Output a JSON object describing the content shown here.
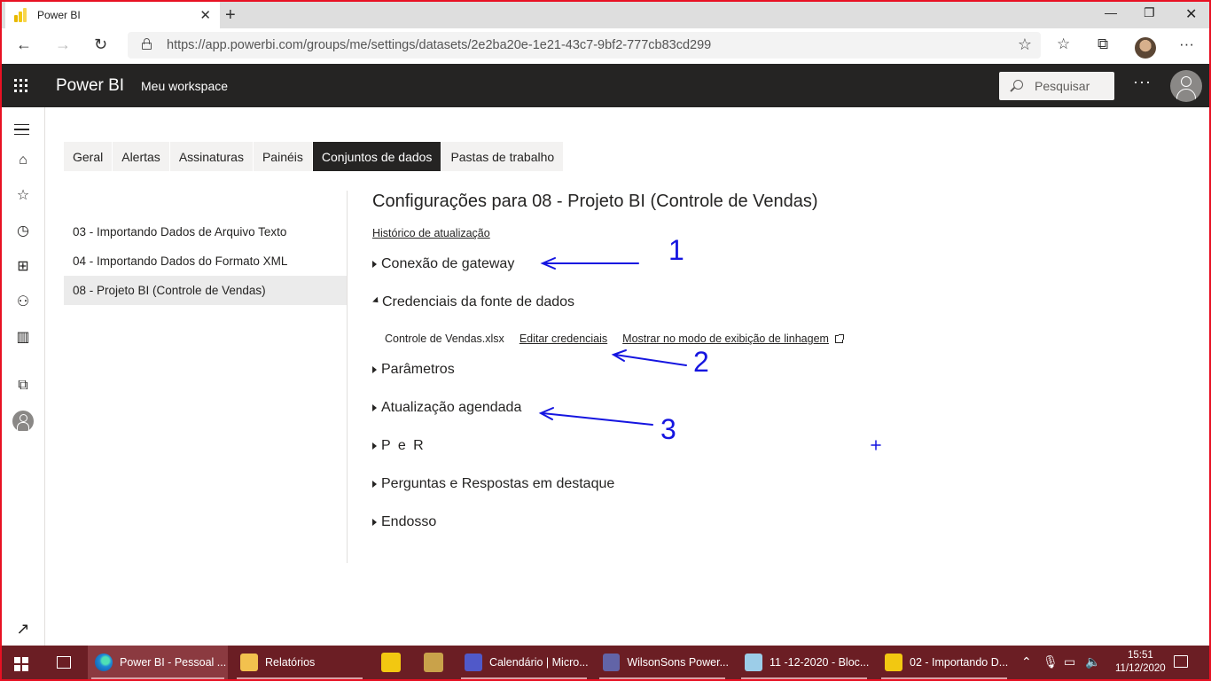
{
  "browser": {
    "tab_title": "Power BI",
    "url": "https://app.powerbi.com/groups/me/settings/datasets/2e2ba20e-1e21-43c7-9bf2-777cb83cd299"
  },
  "header": {
    "brand": "Power BI",
    "workspace": "Meu workspace",
    "search_placeholder": "Pesquisar"
  },
  "tabs": [
    {
      "label": "Geral"
    },
    {
      "label": "Alertas"
    },
    {
      "label": "Assinaturas"
    },
    {
      "label": "Painéis"
    },
    {
      "label": "Conjuntos de dados"
    },
    {
      "label": "Pastas de trabalho"
    }
  ],
  "datasets": [
    {
      "label": "03 - Importando Dados de Arquivo Texto"
    },
    {
      "label": "04 - Importando Dados do Formato XML"
    },
    {
      "label": "08 - Projeto BI (Controle de Vendas)"
    }
  ],
  "content": {
    "title": "Configurações para 08 - Projeto BI (Controle de Vendas)",
    "history_link": "Histórico de atualização",
    "sections": [
      {
        "label": "Conexão de gateway"
      },
      {
        "label": "Credenciais da fonte de dados"
      },
      {
        "label": "Parâmetros"
      },
      {
        "label": "Atualização agendada"
      },
      {
        "label": "P e R"
      },
      {
        "label": "Perguntas e Respostas em destaque"
      },
      {
        "label": "Endosso"
      }
    ],
    "credentials": {
      "file": "Controle de Vendas.xlsx",
      "edit_link": "Editar credenciais",
      "lineage_link": "Mostrar no modo de exibição de linhagem"
    }
  },
  "annotations": [
    {
      "label": "1"
    },
    {
      "label": "2"
    },
    {
      "label": "3"
    }
  ],
  "annotation_color": "#1515e0",
  "taskbar": {
    "items": [
      {
        "label": "Power BI - Pessoal ..."
      },
      {
        "label": "Relatórios"
      },
      {
        "label": "Calendário | Micro..."
      },
      {
        "label": "WilsonSons Power..."
      },
      {
        "label": "11 -12-2020 - Bloc..."
      },
      {
        "label": "02 - Importando D..."
      }
    ],
    "time": "15:51",
    "date": "11/12/2020"
  }
}
